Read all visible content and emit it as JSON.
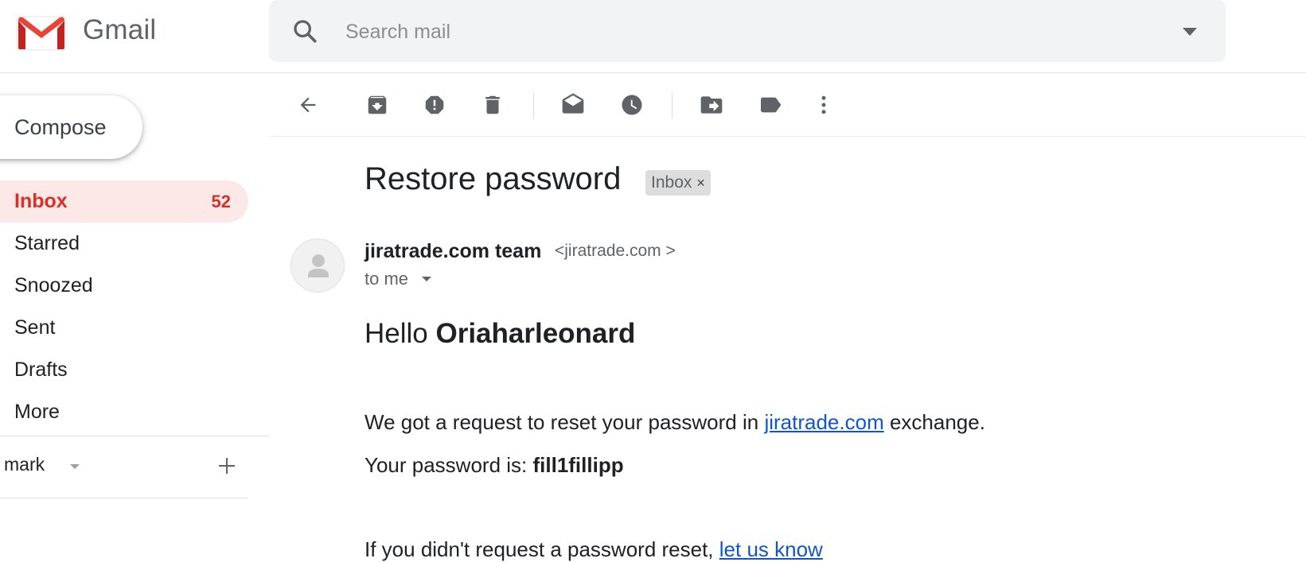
{
  "app": {
    "logo_text": "Gmail",
    "brand_red": "#d93025"
  },
  "search": {
    "placeholder": "Search mail",
    "value": ""
  },
  "sidebar": {
    "compose_label": "Compose",
    "items": [
      {
        "label": "Inbox",
        "count": "52",
        "active": true
      },
      {
        "label": "Starred"
      },
      {
        "label": "Snoozed"
      },
      {
        "label": "Sent"
      },
      {
        "label": "Drafts"
      },
      {
        "label": "More"
      }
    ],
    "labels_section": {
      "title": "mark"
    }
  },
  "toolbar": {
    "icons": [
      "back-arrow-icon",
      "archive-icon",
      "report-spam-icon",
      "delete-icon",
      "mark-unread-icon",
      "snooze-icon",
      "move-to-icon",
      "labels-icon",
      "more-options-icon"
    ]
  },
  "message": {
    "subject": "Restore password",
    "label_chip": "Inbox",
    "label_remove": "×",
    "sender_name": "jiratrade.com team",
    "sender_email": "<jiratrade.com >",
    "recipient": "to me",
    "greeting_prefix": "Hello ",
    "greeting_name": "Oriaharleonard",
    "line1_prefix": "We got a request to reset your password in ",
    "line1_link": "jiratrade.com",
    "line1_suffix": " exchange.",
    "line2_prefix": "Your password is: ",
    "line2_password": "fill1fillipp",
    "line3_prefix": "If you didn't request a password reset, ",
    "line3_link": "let us know"
  }
}
